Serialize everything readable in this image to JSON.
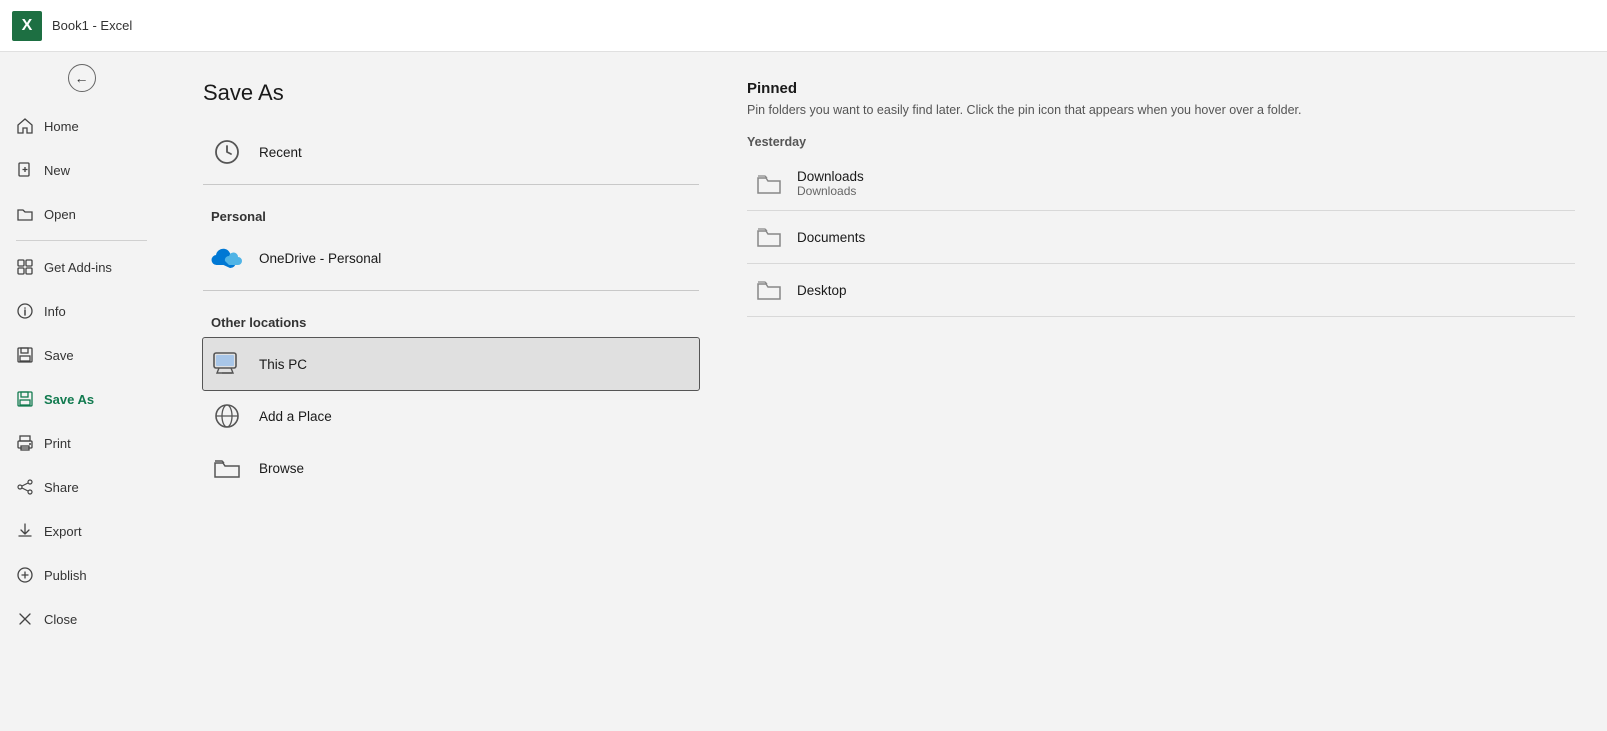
{
  "titlebar": {
    "logo": "X",
    "title": "Book1  -  Excel"
  },
  "sidebar": {
    "back_label": "Back",
    "items": [
      {
        "id": "home",
        "label": "Home",
        "icon": "home"
      },
      {
        "id": "new",
        "label": "New",
        "icon": "new"
      },
      {
        "id": "open",
        "label": "Open",
        "icon": "open"
      },
      {
        "id": "divider1",
        "type": "divider"
      },
      {
        "id": "get-addins",
        "label": "Get Add-ins",
        "icon": "addins"
      },
      {
        "id": "info",
        "label": "Info",
        "icon": "info"
      },
      {
        "id": "save",
        "label": "Save",
        "icon": "save"
      },
      {
        "id": "save-as",
        "label": "Save As",
        "icon": "save-as",
        "active": true
      },
      {
        "id": "print",
        "label": "Print",
        "icon": "print"
      },
      {
        "id": "share",
        "label": "Share",
        "icon": "share"
      },
      {
        "id": "export",
        "label": "Export",
        "icon": "export"
      },
      {
        "id": "publish",
        "label": "Publish",
        "icon": "publish"
      },
      {
        "id": "close",
        "label": "Close",
        "icon": "close"
      }
    ]
  },
  "saveas": {
    "title": "Save As",
    "sections": {
      "recent": {
        "label": "Recent"
      },
      "personal": {
        "label": "Personal"
      },
      "other_locations": {
        "label": "Other locations"
      }
    },
    "locations": [
      {
        "id": "recent",
        "label": "Recent",
        "icon": "clock",
        "section": "top"
      },
      {
        "id": "onedrive",
        "label": "OneDrive - Personal",
        "icon": "cloud",
        "section": "personal"
      },
      {
        "id": "this-pc",
        "label": "This PC",
        "icon": "pc",
        "section": "other",
        "selected": true
      },
      {
        "id": "add-place",
        "label": "Add a Place",
        "icon": "globe",
        "section": "other"
      },
      {
        "id": "browse",
        "label": "Browse",
        "icon": "folder-open",
        "section": "other"
      }
    ]
  },
  "pinned": {
    "title": "Pinned",
    "subtitle": "Pin folders you want to easily find later. Click the pin icon that appears when you hover over a folder.",
    "yesterday_label": "Yesterday",
    "folders": [
      {
        "id": "downloads",
        "name": "Downloads",
        "sub": "Downloads"
      },
      {
        "id": "documents",
        "name": "Documents",
        "sub": ""
      },
      {
        "id": "desktop",
        "name": "Desktop",
        "sub": ""
      }
    ]
  }
}
